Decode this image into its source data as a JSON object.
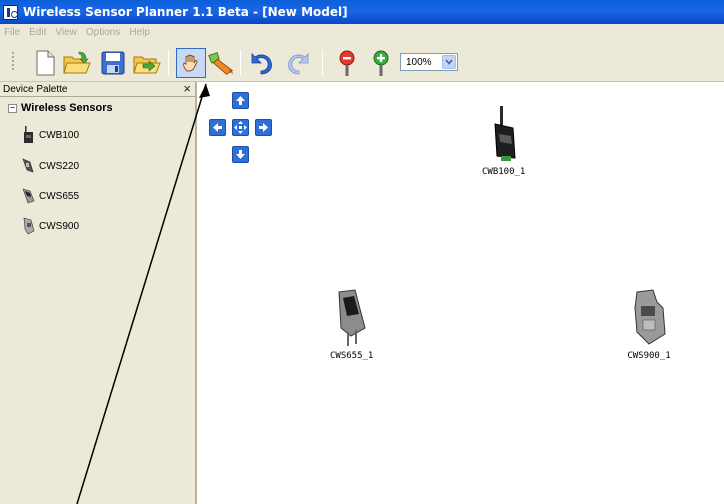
{
  "window": {
    "title": "Wireless Sensor Planner 1.1 Beta - [New Model]"
  },
  "menu": {
    "items": [
      "File",
      "Edit",
      "View",
      "Options",
      "Help"
    ]
  },
  "toolbar": {
    "buttons": [
      "new-file-icon",
      "open-folder-icon",
      "save-icon",
      "export-icon",
      "pan-hand-icon",
      "draw-link-icon",
      "undo-icon",
      "redo-icon",
      "zoom-out-icon",
      "zoom-in-icon"
    ],
    "zoom": "100%"
  },
  "palette": {
    "title": "Device Palette",
    "close": "×",
    "group_toggle": "−",
    "group": "Wireless Sensors",
    "items": [
      {
        "label": "CWB100"
      },
      {
        "label": "CWS220"
      },
      {
        "label": "CWS655"
      },
      {
        "label": "CWS900"
      }
    ]
  },
  "canvas": {
    "devices": [
      {
        "label": "CWB100_1"
      },
      {
        "label": "CWS655_1"
      },
      {
        "label": "CWS900_1"
      }
    ]
  },
  "colors": {
    "titlebar": "#0a5fd8",
    "chrome": "#ece9d8",
    "nav_arrow": "#2e6fd8",
    "menu_disabled": "#aca899"
  }
}
